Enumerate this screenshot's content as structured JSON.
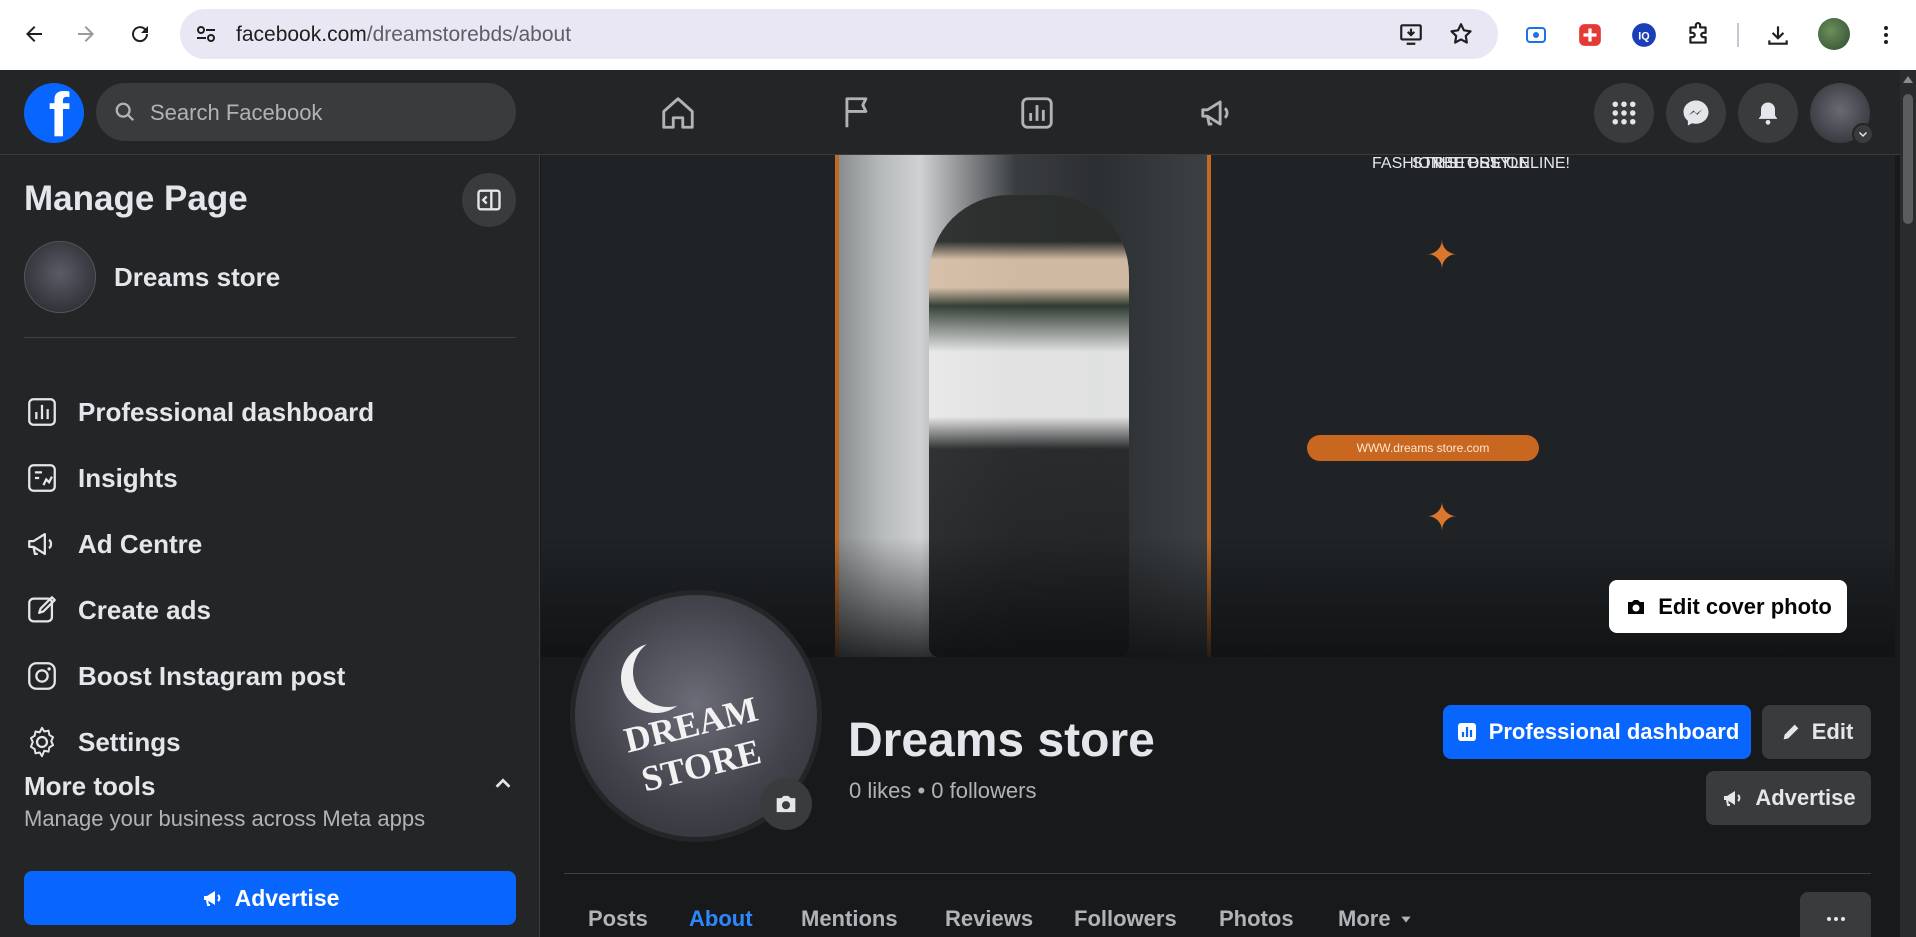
{
  "browser": {
    "url_host": "facebook.com",
    "url_path": "/dreamstorebds/about"
  },
  "fb_nav": {
    "search_placeholder": "Search Facebook"
  },
  "sidebar": {
    "title": "Manage Page",
    "page_name": "Dreams store",
    "items": [
      {
        "label": "Professional dashboard",
        "icon": "dashboard-icon"
      },
      {
        "label": "Insights",
        "icon": "insights-icon"
      },
      {
        "label": "Ad Centre",
        "icon": "megaphone-icon"
      },
      {
        "label": "Create ads",
        "icon": "pencil-square-icon"
      },
      {
        "label": "Boost Instagram post",
        "icon": "instagram-icon"
      },
      {
        "label": "Settings",
        "icon": "gear-icon"
      }
    ],
    "more_tools": "More tools",
    "more_tools_sub": "Manage your business across Meta apps",
    "advertise": "Advertise"
  },
  "cover": {
    "line1": "THE BEST",
    "line2": "STREET STYLE",
    "line3": "FASHION STORE ONLINE!",
    "pill": "WWW.dreams store.com",
    "edit_cover": "Edit cover photo"
  },
  "profile": {
    "logo_text": "DREAM STORE",
    "name": "Dreams store",
    "stats": "0 likes • 0 followers"
  },
  "actions": {
    "professional_dashboard": "Professional dashboard",
    "edit": "Edit",
    "advertise": "Advertise"
  },
  "tabs": [
    {
      "label": "Posts",
      "active": false
    },
    {
      "label": "About",
      "active": true
    },
    {
      "label": "Mentions",
      "active": false
    },
    {
      "label": "Reviews",
      "active": false
    },
    {
      "label": "Followers",
      "active": false
    },
    {
      "label": "Photos",
      "active": false
    },
    {
      "label": "More",
      "active": false
    }
  ],
  "colors": {
    "brand_blue": "#0866ff",
    "active_tab": "#2d88ff",
    "accent_orange": "#d9782d"
  }
}
